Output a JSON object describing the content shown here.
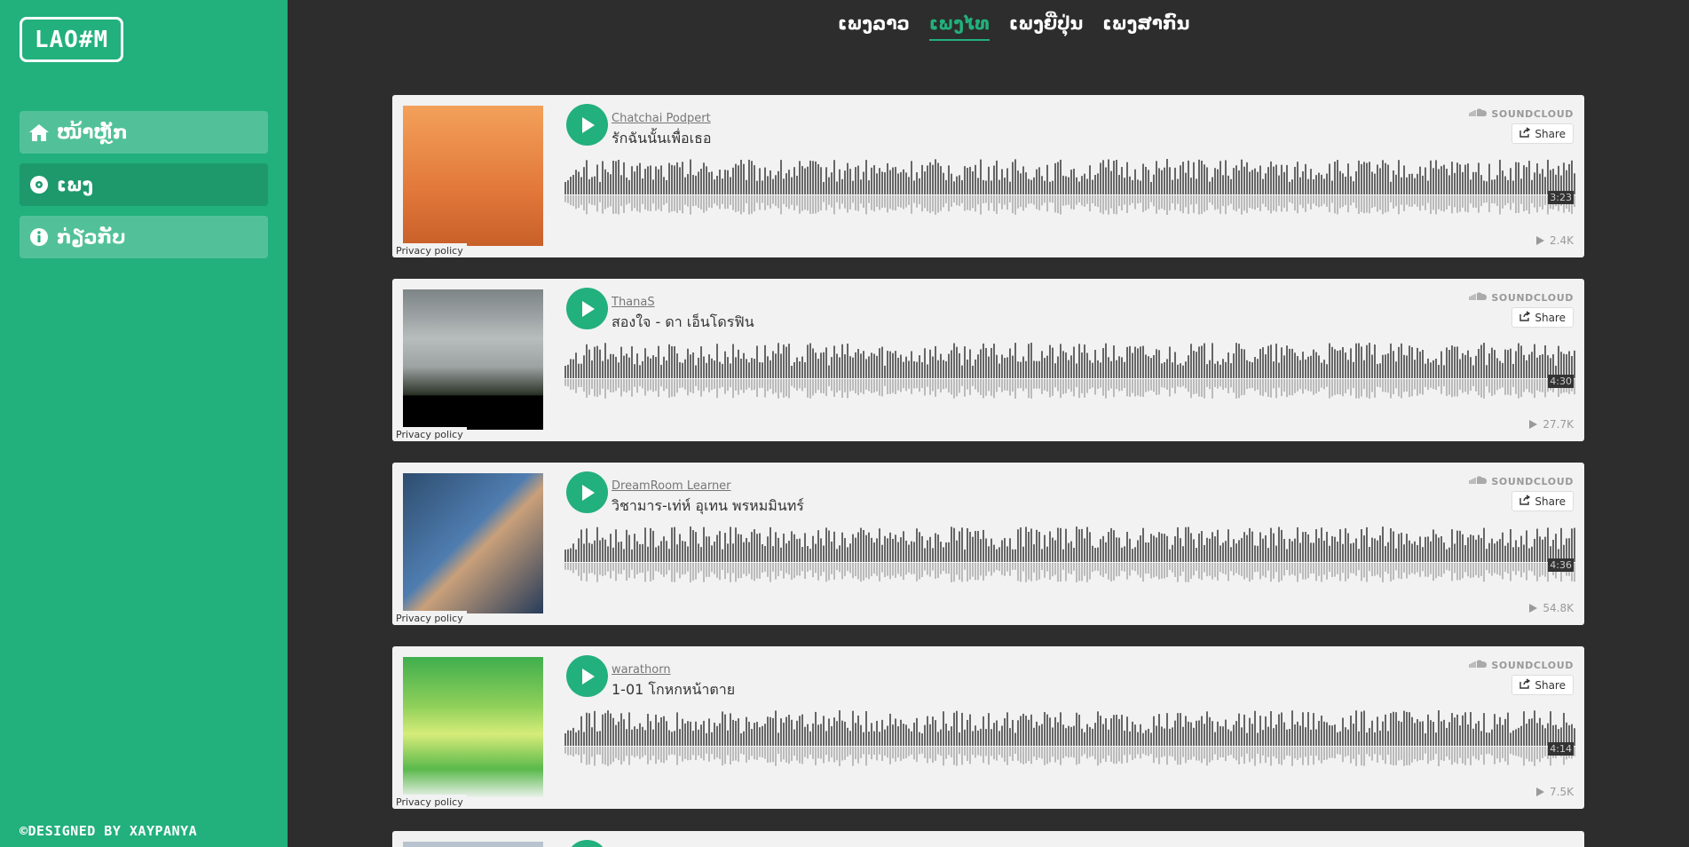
{
  "sidebar": {
    "logo": "LAO#M",
    "items": [
      {
        "label": "ໜ້າຫຼັກ",
        "icon": "home-icon"
      },
      {
        "label": "ເພງ",
        "icon": "disc-icon"
      },
      {
        "label": "ກ່ຽວກັບ",
        "icon": "info-icon"
      }
    ],
    "footer": "©DESIGNED BY XAYPANYA"
  },
  "tabs": [
    {
      "label": "ເພງລາວ"
    },
    {
      "label": "ເພງໄທ"
    },
    {
      "label": "ເພງຍີ່ປຸ່ນ"
    },
    {
      "label": "ເພງສາກົນ"
    }
  ],
  "active_tab": 1,
  "player": {
    "brand": "SOUNDCLOUD",
    "share_label": "Share",
    "privacy_label": "Privacy policy"
  },
  "tracks": [
    {
      "artist": "Chatchai Podpert",
      "title": "รักฉันนั้นเพื่อเธอ",
      "duration": "3:23",
      "plays": "2.4K",
      "art": "orange"
    },
    {
      "artist": "ThanaS",
      "title": "สองใจ - ดา เอ็นโดรฟิน",
      "duration": "4:30",
      "plays": "27.7K",
      "art": "sky"
    },
    {
      "artist": "DreamRoom Learner",
      "title": "วิชามาร-เท่ห์ อุเทน พรหมมินทร์",
      "duration": "4:36",
      "plays": "54.8K",
      "art": "blue"
    },
    {
      "artist": "warathorn",
      "title": "1-01 โกหกหน้าตาย",
      "duration": "4:14",
      "plays": "7.5K",
      "art": "green"
    }
  ],
  "colors": {
    "accent": "#22b07d",
    "background": "#2d2d2d",
    "card": "#f2f2f2"
  }
}
